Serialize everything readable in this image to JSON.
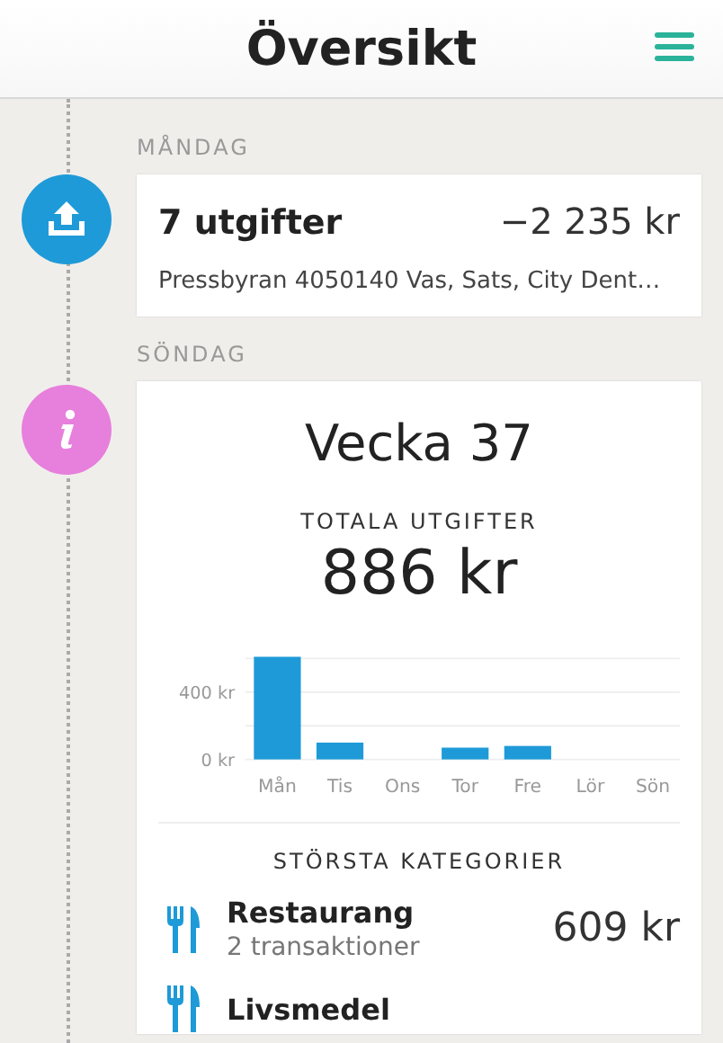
{
  "header": {
    "title": "Översikt"
  },
  "days": [
    {
      "label": "MÅNDAG",
      "card": {
        "kind": "summary",
        "title": "7 utgifter",
        "amount": "−2 235 kr",
        "description": "Pressbyran 4050140 Vas, Sats, City Dent…"
      }
    },
    {
      "label": "SÖNDAG",
      "card": {
        "kind": "week",
        "title": "Vecka 37",
        "total_label": "TOTALA UTGIFTER",
        "total": "886 kr",
        "chart_data": {
          "type": "bar",
          "categories": [
            "Mån",
            "Tis",
            "Ons",
            "Tor",
            "Fre",
            "Lör",
            "Sön"
          ],
          "values": [
            610,
            100,
            0,
            70,
            80,
            0,
            0
          ],
          "ylim": [
            0,
            620
          ],
          "yticks": [
            {
              "value": 0,
              "label": "0 kr"
            },
            {
              "value": 400,
              "label": "400 kr"
            }
          ]
        },
        "categories_heading": "STÖRSTA KATEGORIER",
        "categories": [
          {
            "name": "Restaurang",
            "count": "2 transaktioner",
            "amount": "609 kr"
          },
          {
            "name": "Livsmedel"
          }
        ]
      }
    }
  ]
}
